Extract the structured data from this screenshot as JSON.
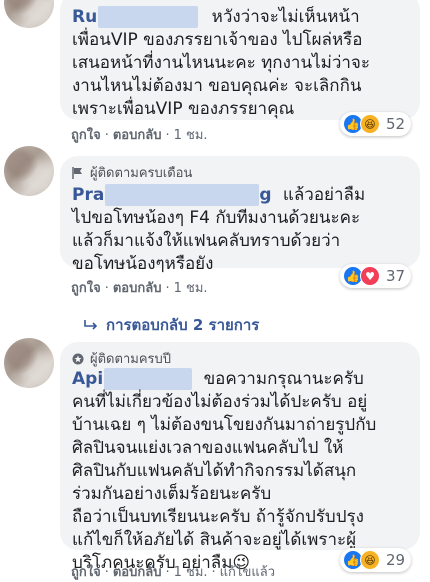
{
  "comments": [
    {
      "badge": "",
      "name": "Ru",
      "lines": [
        "หวังว่าจะไม่เห็นหน้า",
        "เพื่อนVIP ของภรรยาเจ้าของ ไปโผล่หรือ",
        "เสนอหน้าที่งานไหนนะคะ ทุกงานไม่ว่าจะ",
        "งานไหนไม่ต้องมา ขอบคุณค่ะ จะเลิกกิน",
        "เพราะเพื่อนVIP ของภรรยาคุณ"
      ],
      "like": "ถูกใจ",
      "reply": "ตอบกลับ",
      "time": "1 ชม.",
      "reaction_count": "52"
    },
    {
      "badge": "ผู้ติดตามครบเดือน",
      "name": "Pra",
      "name_tail": "g",
      "lines": [
        "แล้วอย่าลืม",
        "ไปขอโทษน้องๆ F4 กับทีมงานด้วยนะคะ",
        "แล้วก็มาแจ้งให้แฟนคลับทราบด้วยว่า",
        "ขอโทษน้องๆหรือยัง"
      ],
      "like": "ถูกใจ",
      "reply": "ตอบกลับ",
      "time": "1 ชม.",
      "reaction_count": "37"
    },
    {
      "badge": "ผู้ติดตามครบปี",
      "name": "Api",
      "lines": [
        "ขอความกรุณานะครับ",
        "คนที่ไม่เกี่ยวข้องไม่ต้องร่วมได้ปะครับ อยู่",
        "บ้านเฉย ๆ ไม่ต้องขนโขยงกันมาถ่ายรูปกับ",
        "ศิลปินจนแย่งเวลาของแฟนคลับไป ให้",
        "ศิลปินกับแฟนคลับได้ทำกิจกรรมได้สนุก",
        "ร่วมกันอย่างเต็มร้อยนะครับ",
        "ถือว่าเป็นบทเรียนนะครับ ถ้ารู้จักปรับปรุง",
        "แก้ไขก็ให้อภัยได้ สินค้าจะอยู่ได้เพราะผู้",
        "บริโภคนะครับ อย่าลืม😉"
      ],
      "like": "ถูกใจ",
      "reply": "ตอบกลับ",
      "time": "1 ชม.",
      "edited": "แก้ไขแล้ว",
      "reaction_count": "29"
    }
  ],
  "replies_link": "การตอบกลับ 2 รายการ",
  "colors": {
    "link": "#385898",
    "bubble": "#f2f3f5",
    "like": "#1877f2",
    "love": "#f33e58",
    "haha": "#f7b125"
  }
}
